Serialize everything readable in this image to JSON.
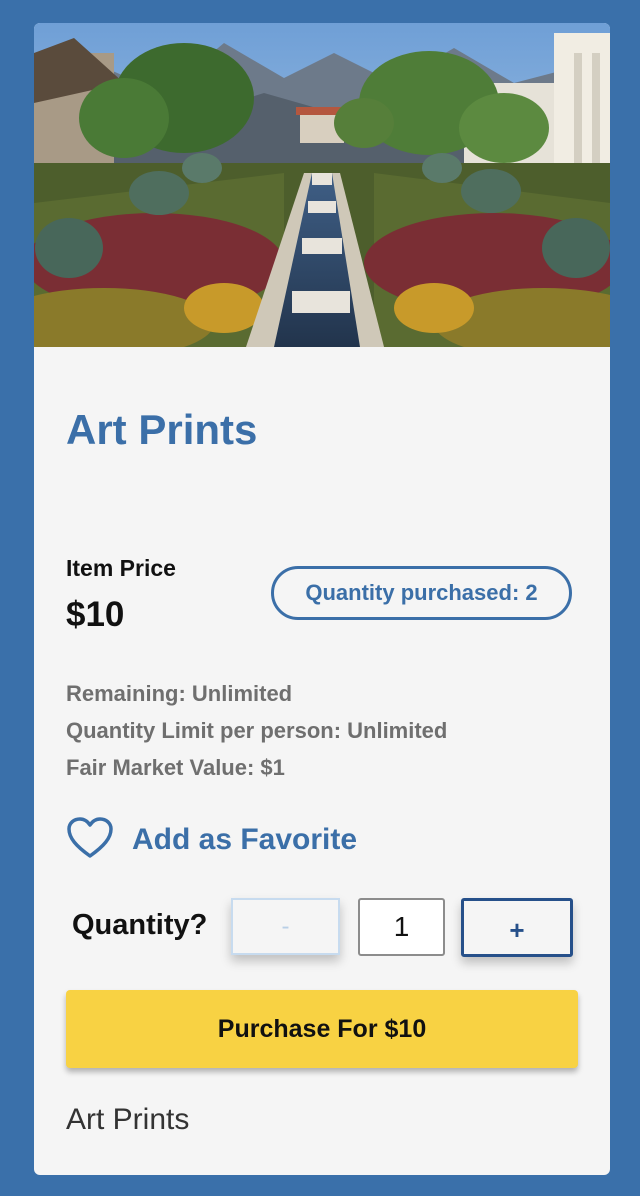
{
  "item": {
    "image_alt": "Garden with water channel, potted plants and mountains",
    "title": "Art Prints",
    "price_label": "Item Price",
    "price": "$10",
    "quantity_purchased": "Quantity purchased: 2",
    "details": [
      "Remaining: Unlimited",
      "Quantity Limit per person: Unlimited",
      "Fair Market Value: $1"
    ],
    "favorite_label": "Add as Favorite",
    "favorite_icon": "heart-outline-icon",
    "quantity_label": "Quantity?",
    "decrement_label": "-",
    "quantity_value": "1",
    "increment_label": "+",
    "purchase_label": "Purchase For $10",
    "footer_name": "Art Prints"
  },
  "colors": {
    "page_background": "#3a70aa",
    "accent": "#3b6fa8",
    "purchase_button": "#f8d243"
  }
}
